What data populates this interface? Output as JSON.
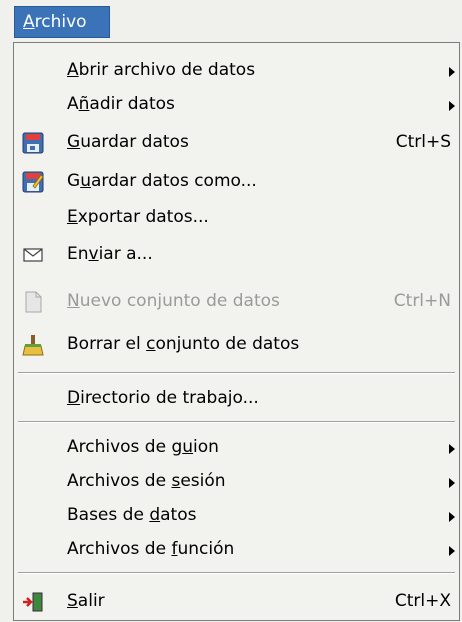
{
  "menu": {
    "title_mnemonic": "A",
    "title_rest": "rchivo",
    "items": [
      {
        "pre": "",
        "mn": "A",
        "post": "brir archivo de datos",
        "shortcut": ""
      },
      {
        "pre": "A",
        "mn": "ñ",
        "post": "adir datos",
        "shortcut": ""
      },
      {
        "pre": "",
        "mn": "G",
        "post": "uardar datos",
        "shortcut": "Ctrl+S"
      },
      {
        "pre": "G",
        "mn": "u",
        "post": "ardar datos como...",
        "shortcut": ""
      },
      {
        "pre": "",
        "mn": "E",
        "post": "xportar datos...",
        "shortcut": ""
      },
      {
        "pre": "En",
        "mn": "v",
        "post": "iar a...",
        "shortcut": ""
      },
      {
        "pre": "",
        "mn": "N",
        "post": "uevo conjunto de datos",
        "shortcut": "Ctrl+N"
      },
      {
        "pre": "Borrar el ",
        "mn": "c",
        "post": "onjunto de datos",
        "shortcut": ""
      },
      {
        "pre": "",
        "mn": "D",
        "post": "irectorio de trabajo...",
        "shortcut": ""
      },
      {
        "pre": "Archivos de g",
        "mn": "u",
        "post": "ion",
        "shortcut": ""
      },
      {
        "pre": "Archivos de ",
        "mn": "s",
        "post": "esión",
        "shortcut": ""
      },
      {
        "pre": "Bases de ",
        "mn": "d",
        "post": "atos",
        "shortcut": ""
      },
      {
        "pre": "Archivos de ",
        "mn": "f",
        "post": "unción",
        "shortcut": ""
      },
      {
        "pre": "",
        "mn": "S",
        "post": "alir",
        "shortcut": "Ctrl+X"
      }
    ]
  }
}
